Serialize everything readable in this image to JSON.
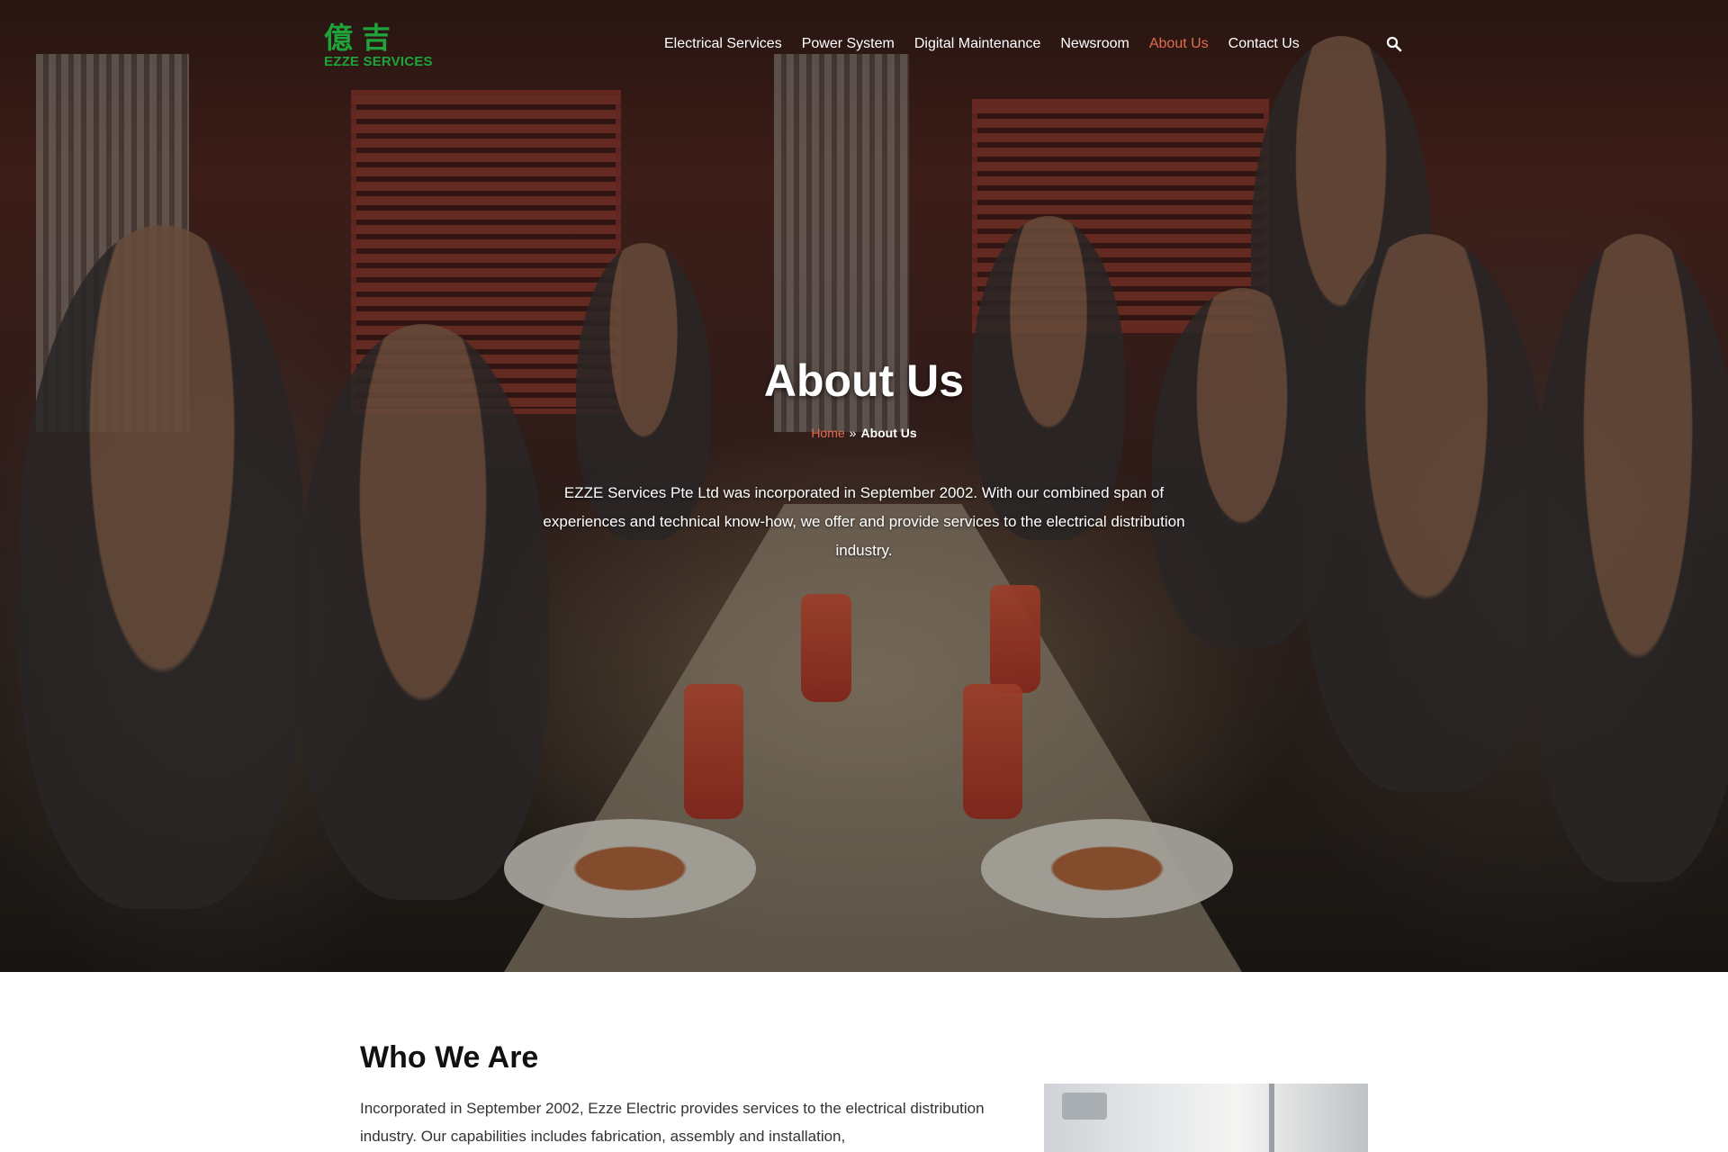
{
  "brand": {
    "logo_cn": "億吉",
    "logo_en": "EZZE SERVICES",
    "color": "#1fa33a"
  },
  "nav": {
    "items": [
      {
        "label": "Electrical Services",
        "active": false
      },
      {
        "label": "Power System",
        "active": false
      },
      {
        "label": "Digital Maintenance",
        "active": false
      },
      {
        "label": "Newsroom",
        "active": false
      },
      {
        "label": "About Us",
        "active": true
      },
      {
        "label": "Contact Us",
        "active": false
      }
    ],
    "search_icon": "search-icon",
    "active_color": "#e56b4f"
  },
  "hero": {
    "title": "About Us",
    "breadcrumb": {
      "home": "Home",
      "separator": "»",
      "current": "About Us"
    },
    "description": "EZZE Services Pte Ltd was incorporated in September 2002. With our combined span of experiences and technical know-how, we offer and provide services to the electrical distribution industry."
  },
  "who_we_are": {
    "title": "Who We Are",
    "body": "Incorporated in September 2002, Ezze Electric provides services to the electrical distribution industry. Our capabilities includes fabrication, assembly and installation,"
  }
}
